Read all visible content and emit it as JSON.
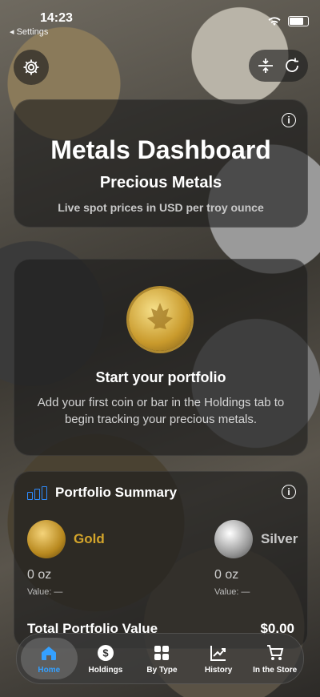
{
  "status": {
    "time": "14:23",
    "back_app": "Settings"
  },
  "header": {
    "title": "Metals Dashboard",
    "subtitle": "Precious Metals",
    "description": "Live spot prices in USD per troy ounce"
  },
  "empty_state": {
    "title": "Start your portfolio",
    "body": "Add your first coin or bar in the Holdings tab to begin tracking your precious metals."
  },
  "summary": {
    "title": "Portfolio Summary",
    "metals": [
      {
        "name": "Gold",
        "amount": "0 oz",
        "value": "Value: —",
        "color": "#d4a52b"
      },
      {
        "name": "Silver",
        "amount": "0 oz",
        "value": "Value: —",
        "color": "#c8c8c8"
      }
    ],
    "total_label": "Total Portfolio Value",
    "total_value": "$0.00"
  },
  "tabs": [
    {
      "label": "Home",
      "icon": "home-icon",
      "active": true
    },
    {
      "label": "Holdings",
      "icon": "dollar-coin-icon"
    },
    {
      "label": "By Type",
      "icon": "grid-icon"
    },
    {
      "label": "History",
      "icon": "chart-icon"
    },
    {
      "label": "In the Store",
      "icon": "cart-icon"
    }
  ],
  "colors": {
    "accent": "#34a0ff",
    "summary_icon": "#2e8cff"
  }
}
